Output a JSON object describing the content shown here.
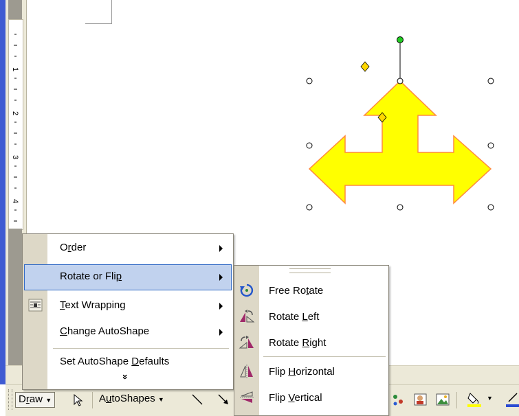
{
  "ruler": {
    "numbers": [
      "1",
      "2",
      "3",
      "4"
    ]
  },
  "menu": {
    "items": [
      {
        "pre": "O",
        "key": "r",
        "post": "der",
        "has_arrow": true
      },
      {
        "pre": "Rotate or Fli",
        "key": "p",
        "post": "",
        "has_arrow": true,
        "highlighted": true
      },
      {
        "pre": "",
        "key": "T",
        "post": "ext Wrapping",
        "has_arrow": true,
        "icon": "text-wrapping-icon"
      },
      {
        "pre": "",
        "key": "C",
        "post": "hange AutoShape",
        "has_arrow": true
      },
      {
        "pre": "Set AutoShape ",
        "key": "D",
        "post": "efaults",
        "has_arrow": false
      }
    ],
    "expand": "»"
  },
  "submenu": {
    "items": [
      {
        "pre": "Free Ro",
        "key": "t",
        "post": "ate",
        "icon": "free-rotate-icon"
      },
      {
        "pre": "Rotate ",
        "key": "L",
        "post": "eft",
        "icon": "rotate-left-icon"
      },
      {
        "pre": "Rotate ",
        "key": "R",
        "post": "ight",
        "icon": "rotate-right-icon"
      },
      {
        "pre": "Flip ",
        "key": "H",
        "post": "orizontal",
        "icon": "flip-horizontal-icon"
      },
      {
        "pre": "Flip ",
        "key": "V",
        "post": "ertical",
        "icon": "flip-vertical-icon"
      }
    ]
  },
  "toolbar": {
    "draw_pre": "D",
    "draw_key": "r",
    "draw_post": "aw",
    "autoshapes_pre": "A",
    "autoshapes_key": "u",
    "autoshapes_post": "toShapes"
  },
  "colors": {
    "shape_fill": "#ffff00",
    "shape_stroke": "#ff8a3d",
    "highlight": "#c1d2ee",
    "highlight_border": "#316ac5",
    "rotation_handle": "#22cc22",
    "adjust_handle": "#ffd800"
  }
}
